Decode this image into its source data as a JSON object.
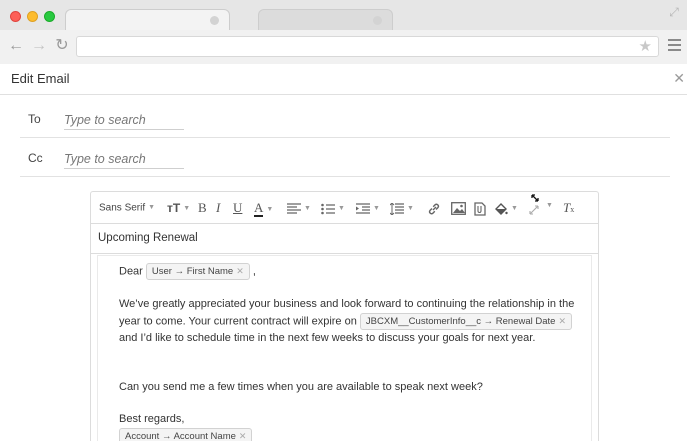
{
  "browser": {
    "url": "",
    "colors": {
      "close": "#fd5f57",
      "minimize": "#fdbc2e",
      "maximize": "#28c940"
    }
  },
  "header": {
    "title": "Edit Email"
  },
  "fields": {
    "to": {
      "label": "To",
      "placeholder": "Type to search",
      "value": ""
    },
    "cc": {
      "label": "Cc",
      "placeholder": "Type to search",
      "value": ""
    }
  },
  "toolbar": {
    "font": "Sans Serif",
    "icons": [
      "font-size-icon",
      "bold-icon",
      "italic-icon",
      "underline-icon",
      "text-color-icon",
      "align-icon",
      "list-icon",
      "indent-icon",
      "line-height-icon",
      "link-icon",
      "image-icon",
      "attachment-icon",
      "fill-color-icon",
      "expand-icon",
      "clear-format-icon"
    ],
    "glyphs": {
      "font_size": "ᴛT",
      "bold": "B",
      "italic": "I",
      "underline": "U",
      "text_color": "A",
      "clear": "T"
    }
  },
  "email": {
    "subject": "Upcoming Renewal",
    "greeting_word": "Dear",
    "greeting_chip": "User → First Name",
    "greeting_end": ",",
    "p1": "We’ve greatly appreciated your business and look forward to continuing the relationship in the year to come. Your current contract will expire on",
    "p1_chip": "JBCXM__CustomerInfo__c → Renewal Date",
    "p1_tail": "and I’d like to schedule time in the next few weeks to discuss your goals for next year.",
    "p2": "Can you send me a few times when you are available to speak next week?",
    "closing": "Best regards,",
    "signature_chip": "Account → Account Name"
  }
}
